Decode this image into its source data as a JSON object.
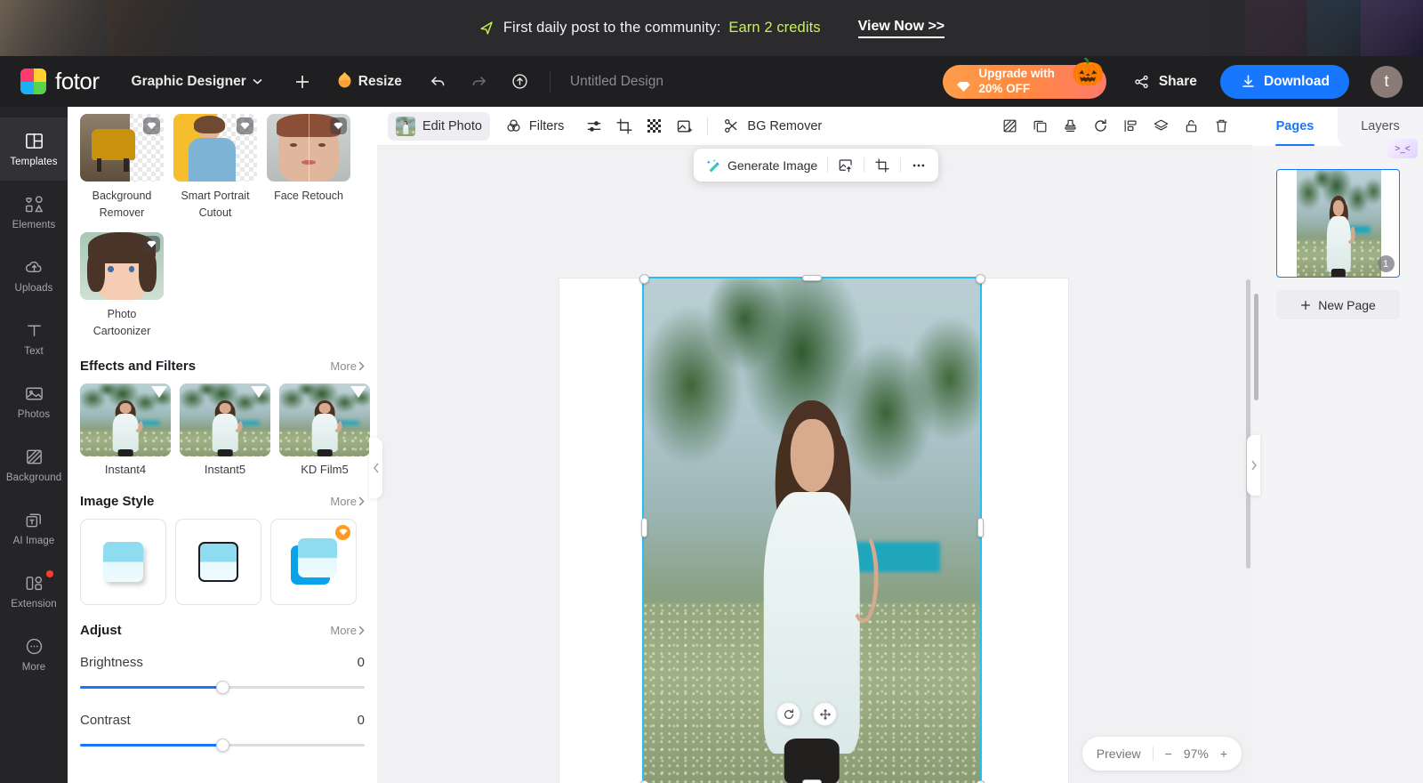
{
  "promo": {
    "icon": "rocket-icon",
    "text_before": "First daily post to the community:",
    "credits_text": "Earn 2 credits",
    "cta": "View Now >>"
  },
  "topbar": {
    "logo_text": "fotor",
    "workspace": "Graphic Designer",
    "chevron": "⌄",
    "add_label": "+",
    "resize_label": "Resize",
    "undo_icon": "undo-icon",
    "redo_icon": "redo-icon",
    "cloud_icon": "cloud-upload-icon",
    "doc_title": "Untitled Design",
    "upgrade_label": "Upgrade with\n20% OFF",
    "pumpkin": "🎃",
    "share_label": "Share",
    "download_label": "Download",
    "avatar_initial": "t"
  },
  "rail": {
    "items": [
      {
        "label": "Templates",
        "icon": "templates-icon",
        "active": true,
        "dot": false
      },
      {
        "label": "Elements",
        "icon": "elements-icon",
        "active": false,
        "dot": false
      },
      {
        "label": "Uploads",
        "icon": "uploads-icon",
        "active": false,
        "dot": false
      },
      {
        "label": "Text",
        "icon": "text-icon",
        "active": false,
        "dot": false
      },
      {
        "label": "Photos",
        "icon": "photos-icon",
        "active": false,
        "dot": false
      },
      {
        "label": "Background",
        "icon": "background-icon",
        "active": false,
        "dot": false
      },
      {
        "label": "AI Image",
        "icon": "ai-image-icon",
        "active": false,
        "dot": false
      },
      {
        "label": "Extension",
        "icon": "extension-icon",
        "active": false,
        "dot": true
      },
      {
        "label": "More",
        "icon": "more-icon",
        "active": false,
        "dot": false
      }
    ]
  },
  "panel": {
    "tools": [
      {
        "name": "Background Remover",
        "badge": "gem"
      },
      {
        "name": "Smart Portrait Cutout",
        "badge": "gem"
      },
      {
        "name": "Face Retouch",
        "badge": "gem"
      },
      {
        "name": "Photo Cartoonizer",
        "badge": "gem"
      }
    ],
    "effects": {
      "title": "Effects and Filters",
      "more": "More",
      "items": [
        {
          "name": "Instant4"
        },
        {
          "name": "Instant5"
        },
        {
          "name": "KD Film5"
        }
      ]
    },
    "image_style": {
      "title": "Image Style",
      "more": "More",
      "items": [
        {
          "name": "plain-shadow-style",
          "badge": ""
        },
        {
          "name": "outline-style",
          "badge": ""
        },
        {
          "name": "offset-style",
          "badge": "gem"
        }
      ]
    },
    "adjust": {
      "title": "Adjust",
      "more": "More",
      "sliders": [
        {
          "label": "Brightness",
          "value": "0"
        },
        {
          "label": "Contrast",
          "value": "0"
        }
      ]
    }
  },
  "canvas_toolbar": {
    "edit_photo": "Edit Photo",
    "filters": "Filters",
    "adjust_icon": "adjust-sliders-icon",
    "crop_icon": "crop-icon",
    "transparency_icon": "transparency-icon",
    "image_effects_icon": "image-enhance-icon",
    "bg_remover": "BG Remover",
    "right_icons": [
      "mask-icon",
      "duplicate-icon",
      "stamp-icon",
      "rotate-icon",
      "align-icon",
      "layers-icon",
      "lock-icon",
      "delete-icon"
    ]
  },
  "float_toolbar": {
    "generate_image": "Generate Image",
    "replace_icon": "replace-image-icon",
    "crop_icon": "crop-icon",
    "more_icon": "more-dots-icon"
  },
  "object_controls": {
    "rotate_icon": "rotate-object-icon",
    "move_icon": "move-object-icon"
  },
  "zoombar": {
    "preview": "Preview",
    "minus": "−",
    "level": "97%",
    "plus": "+"
  },
  "right_panel": {
    "tabs": [
      {
        "label": "Pages",
        "active": true
      },
      {
        "label": "Layers",
        "active": false
      }
    ],
    "ai_badge": ">_<",
    "page_number": "1",
    "new_page": "New Page",
    "new_page_icon": "plus-icon"
  },
  "colors": {
    "accent_blue": "#1877ff",
    "promo_green": "#c8f54a",
    "selection_cyan": "#21c1f3",
    "upgrade_orange": "#ff8a3d",
    "dark_chrome": "#1f1f21",
    "rail_bg": "#252528",
    "canvas_bg": "#f1f1f3",
    "badge_red": "#ff3b30"
  }
}
